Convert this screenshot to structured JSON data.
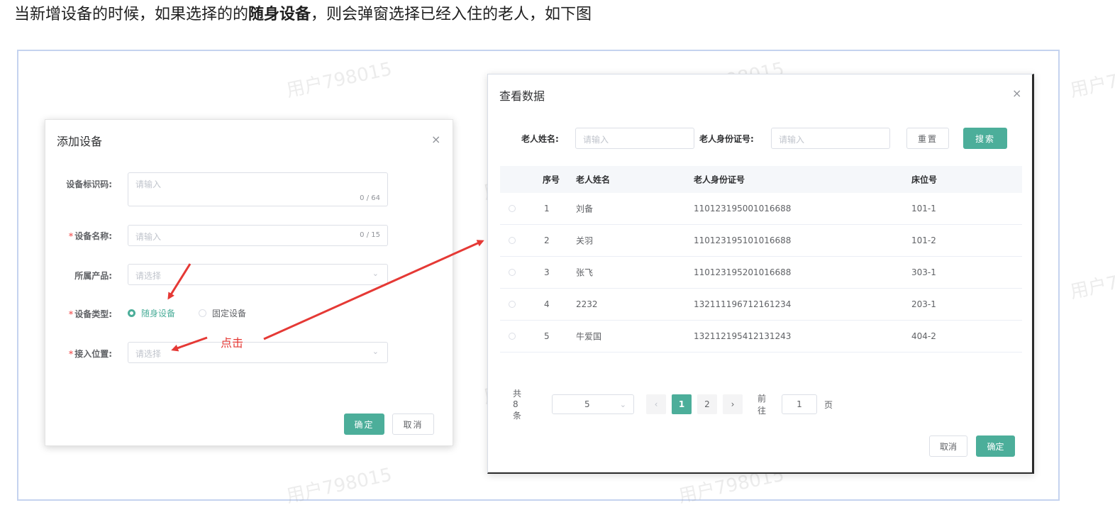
{
  "caption": {
    "before": "当新增设备的时候，如果选择的的",
    "bold": "随身设备",
    "after": "，则会弹窗选择已经入住的老人，如下图"
  },
  "watermark": "用户798015",
  "add_dialog": {
    "title": "添加设备",
    "close": "×",
    "fields": {
      "device_code": {
        "label": "设备标识码:",
        "placeholder": "请输入",
        "count": "0 / 64"
      },
      "device_name": {
        "required": "*",
        "label": "设备名称:",
        "placeholder": "请输入",
        "count": "0 / 15"
      },
      "product": {
        "label": "所属产品:",
        "placeholder": "请选择"
      },
      "device_type": {
        "required": "*",
        "label": "设备类型:",
        "options": [
          "随身设备",
          "固定设备"
        ],
        "selected": "随身设备"
      },
      "location": {
        "required": "*",
        "label": "接入位置:",
        "placeholder": "请选择"
      }
    },
    "confirm": "确定",
    "cancel": "取消"
  },
  "annotation": {
    "click_label": "点击"
  },
  "view_dialog": {
    "title": "查看数据",
    "close": "×",
    "search": {
      "name_label": "老人姓名:",
      "name_placeholder": "请输入",
      "id_label": "老人身份证号:",
      "id_placeholder": "请输入",
      "reset": "重置",
      "search": "搜索"
    },
    "columns": [
      "序号",
      "老人姓名",
      "老人身份证号",
      "床位号"
    ],
    "rows": [
      [
        "1",
        "刘备",
        "110123195001016688",
        "101-1"
      ],
      [
        "2",
        "关羽",
        "110123195101016688",
        "101-2"
      ],
      [
        "3",
        "张飞",
        "110123195201016688",
        "303-1"
      ],
      [
        "4",
        "2232",
        "132111196712161234",
        "203-1"
      ],
      [
        "5",
        "牛爱国",
        "132112195412131243",
        "404-2"
      ]
    ],
    "pagination": {
      "total": "共 8 条",
      "page_size": "5",
      "prev": "‹",
      "pages": [
        "1",
        "2"
      ],
      "current": "1",
      "next": "›",
      "goto_label": "前往",
      "goto_value": "1",
      "page_suffix": "页"
    },
    "cancel": "取消",
    "confirm": "确定"
  },
  "colors": {
    "primary": "#4cae9a",
    "annotation": "#e53935",
    "required": "#f56c6c"
  }
}
